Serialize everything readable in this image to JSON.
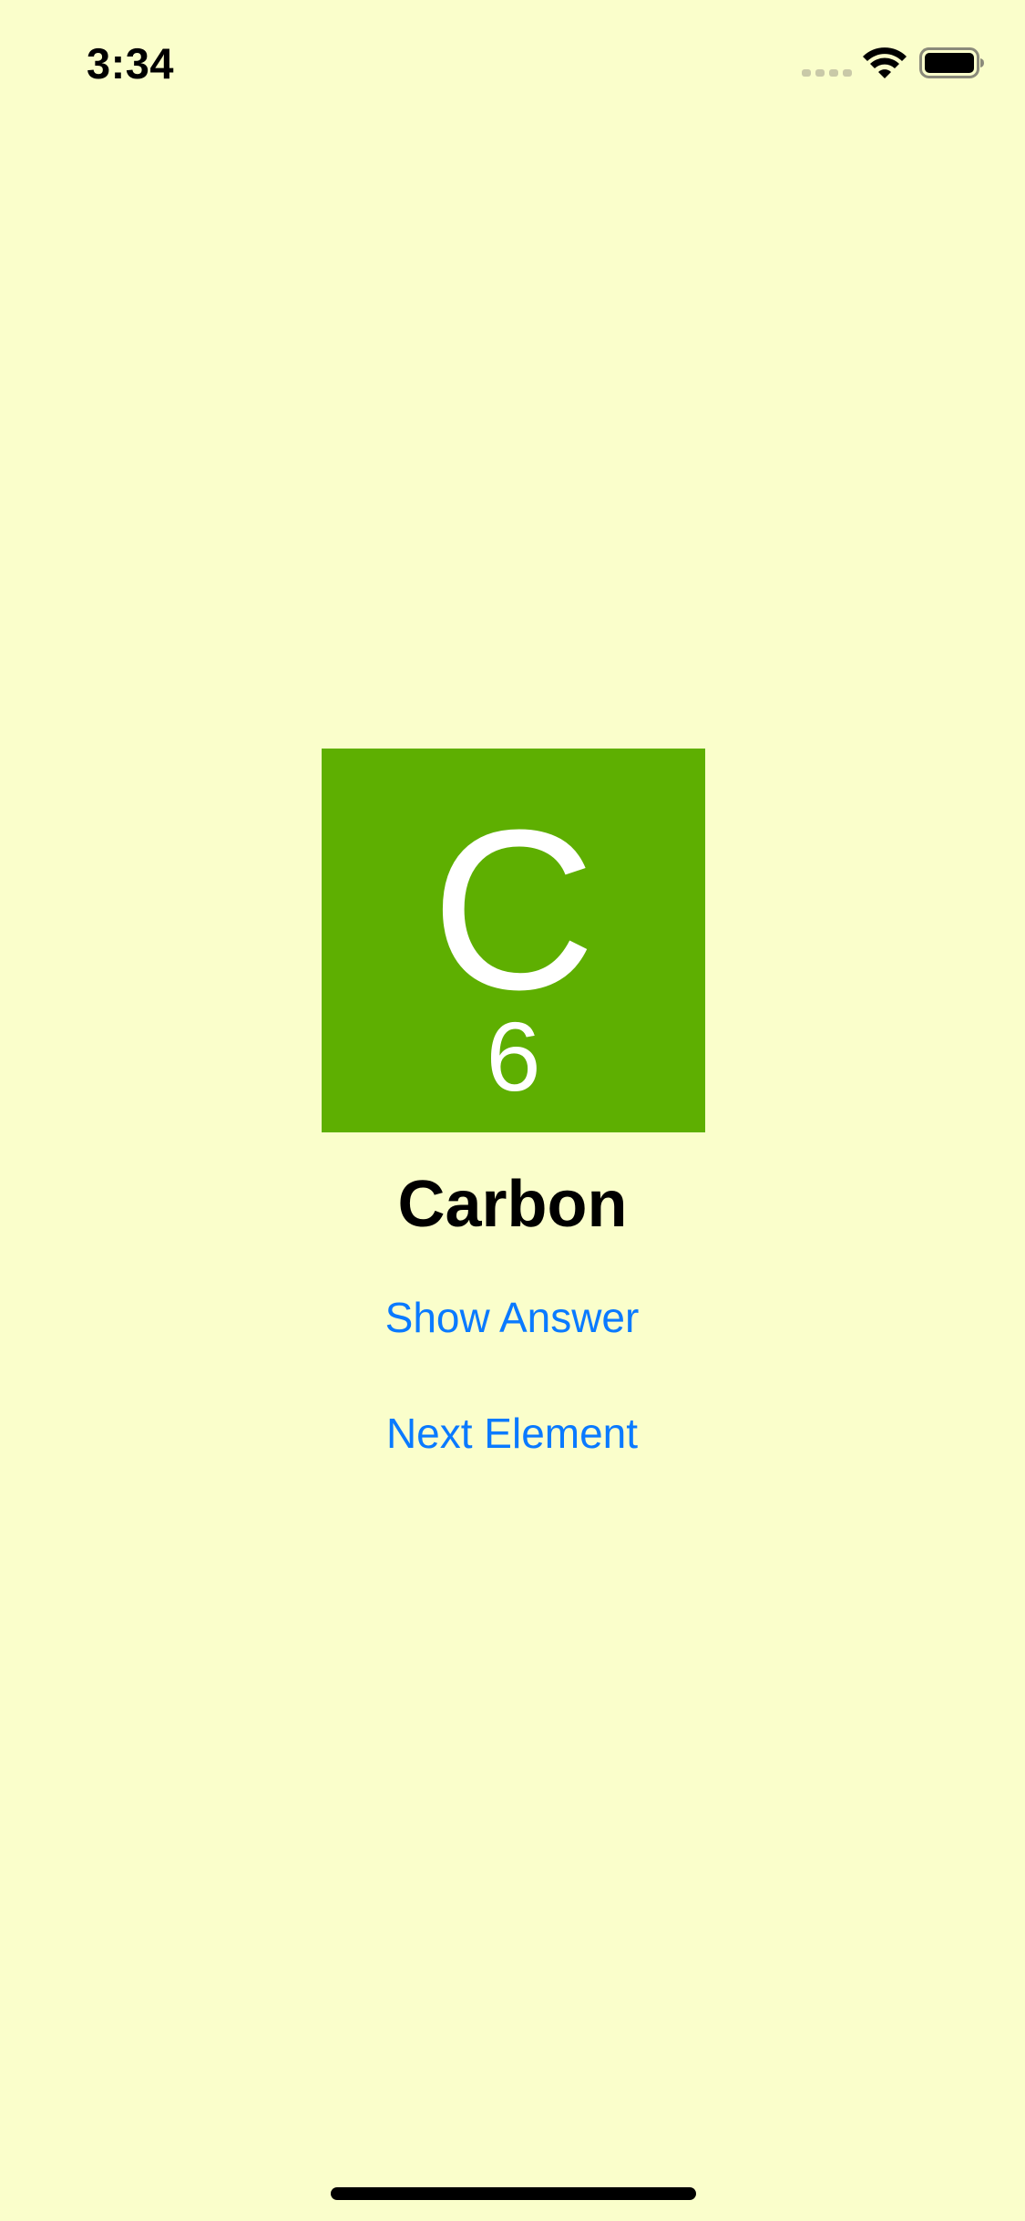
{
  "status_bar": {
    "time": "3:34"
  },
  "element": {
    "symbol": "C",
    "atomic_number": "6",
    "name": "Carbon",
    "tile_color": "#5eaf01"
  },
  "actions": {
    "show_answer_label": "Show Answer",
    "next_element_label": "Next Element"
  },
  "colors": {
    "background": "#fafecb",
    "accent": "#0a7aff"
  },
  "icons": [
    "signal-icon",
    "wifi-icon",
    "battery-icon"
  ]
}
